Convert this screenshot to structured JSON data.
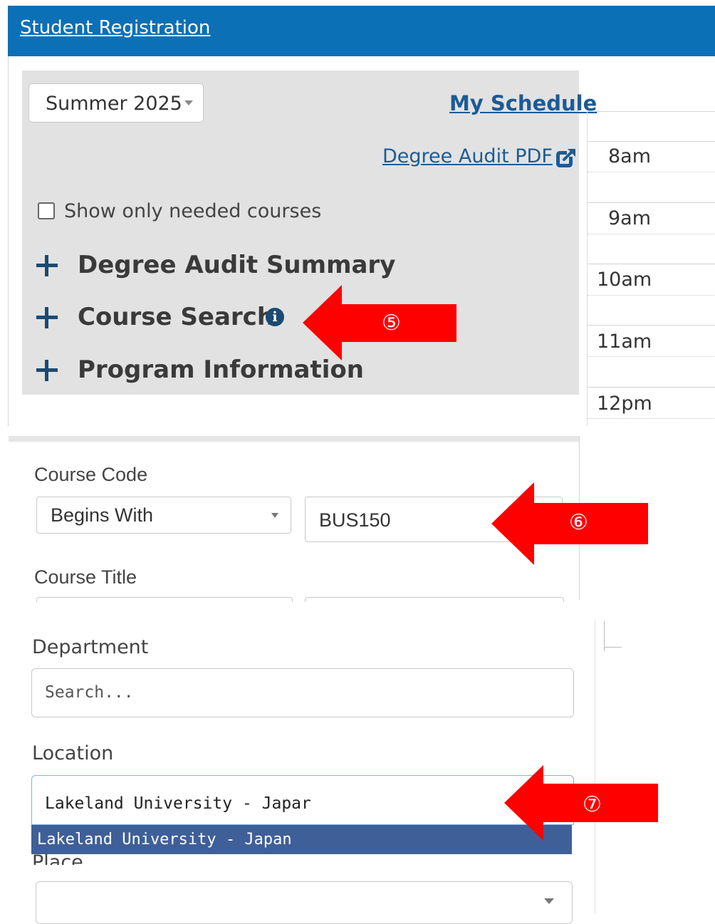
{
  "header": {
    "title": "Student Registration"
  },
  "term_selector": {
    "selected": "Summer 2025"
  },
  "links": {
    "my_schedule": "My Schedule",
    "degree_audit_pdf": "Degree Audit PDF"
  },
  "filters": {
    "show_needed_label": "Show only needed courses",
    "show_needed_checked": false
  },
  "accordions": [
    {
      "label": "Degree Audit Summary"
    },
    {
      "label": "Course Search"
    },
    {
      "label": "Program Information"
    }
  ],
  "schedule": {
    "times": [
      "8am",
      "9am",
      "10am",
      "11am",
      "12pm"
    ]
  },
  "annotations": {
    "arrow5": "⑤",
    "arrow6": "⑥",
    "arrow7": "⑦"
  },
  "course_search": {
    "course_code_label": "Course Code",
    "match_type": "Begins With",
    "course_code_value": "BUS150",
    "course_title_label": "Course Title"
  },
  "filters_panel": {
    "department_label": "Department",
    "department_placeholder": "Search...",
    "location_label": "Location",
    "location_value": "Lakeland University - Japar",
    "location_option": "Lakeland University - Japan",
    "place_label": "Place"
  },
  "colors": {
    "header_blue": "#0c70b6",
    "link_blue": "#1c5b93",
    "arrow_red": "#ff0000",
    "option_highlight": "#3f5f98"
  }
}
